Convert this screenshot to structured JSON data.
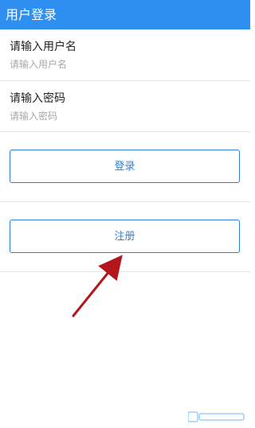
{
  "header": {
    "title": "用户登录"
  },
  "form": {
    "username": {
      "label": "请输入用户名",
      "placeholder": "请输入用户名",
      "value": ""
    },
    "password": {
      "label": "请输入密码",
      "placeholder": "请输入密码",
      "value": ""
    }
  },
  "actions": {
    "login_label": "登录",
    "register_label": "注册"
  },
  "colors": {
    "header_bg": "#2f8ff0",
    "accent": "#2f7fd8",
    "arrow": "#b3161b"
  },
  "icons": {
    "arrow": "red-arrow-annotation",
    "watermark": "watermark-logo"
  }
}
